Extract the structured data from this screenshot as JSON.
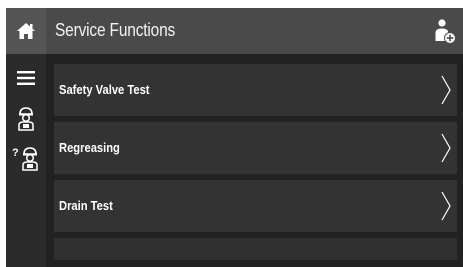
{
  "header": {
    "title": "Service Functions",
    "user_icon": "user-settings-icon"
  },
  "sidebar": {
    "items": [
      {
        "name": "home",
        "icon": "home-icon",
        "active": true
      },
      {
        "name": "menu",
        "icon": "hamburger-menu-icon"
      },
      {
        "name": "technician",
        "icon": "technician-icon"
      },
      {
        "name": "technician-help",
        "icon": "technician-help-icon"
      }
    ]
  },
  "list": {
    "items": [
      {
        "label": "Safety Valve Test",
        "icon": "chevron-right-icon"
      },
      {
        "label": "Regreasing",
        "icon": "chevron-right-icon"
      },
      {
        "label": "Drain Test",
        "icon": "chevron-right-icon"
      }
    ]
  },
  "colors": {
    "background": "#222222",
    "header": "#4a4a4a",
    "home_active": "#555555",
    "row": "#333333",
    "text": "#ffffff"
  }
}
